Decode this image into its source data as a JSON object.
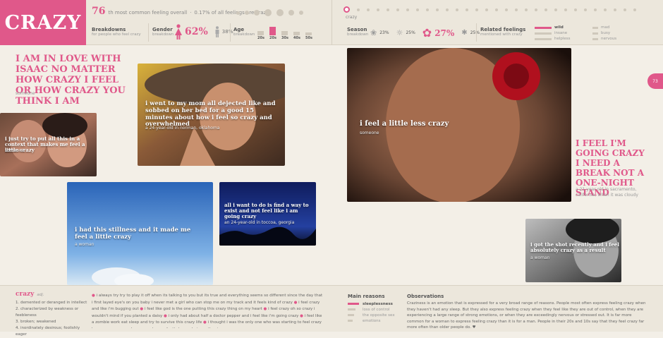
{
  "title": "CRAZY",
  "rank": {
    "number": "76",
    "suffix": "th most common feeling overall",
    "percent_text": "0.17% of all feelings are crazy"
  },
  "breakdowns": {
    "title": "Breakdowns",
    "sub": "for people who feel crazy"
  },
  "gender": {
    "title": "Gender",
    "sub": "breakdown",
    "female": "62%",
    "male": "38%"
  },
  "age": {
    "title": "Age",
    "sub": "breakdown",
    "labels": [
      "20s",
      "20s",
      "30s",
      "40s",
      "50s"
    ],
    "levels": [
      0.5,
      1.0,
      0.5,
      0.4,
      0.3
    ]
  },
  "nav_label": "crazy",
  "season": {
    "title": "Season",
    "sub": "breakdown",
    "values": [
      "23%",
      "25%",
      "27%",
      "25%"
    ]
  },
  "related": {
    "title": "Related feelings",
    "sub": "mentioned with crazy",
    "col1": [
      "wild",
      "insane",
      "helpless"
    ],
    "col2": [
      "mad",
      "busy",
      "nervous"
    ]
  },
  "page_number": "73",
  "quotes": {
    "q1": {
      "text": "i am in love with isaac no matter how crazy i feel or how crazy you think i am",
      "author": "someone"
    },
    "q2": {
      "text": "i just try to put all this in a context that makes me feel a little crazy",
      "author": "someone"
    },
    "q3": {
      "text": "i went to my mom all dejected like and sobbed on her bed for a good 15 minutes about how i feel so crazy and overwhelmed",
      "author": "a 24-year-old in norman, oklahoma"
    },
    "q4": {
      "text": "i had this stillness and it made me feel a little crazy",
      "author": "a woman"
    },
    "q5": {
      "text": "all i want to do is find a way to exist and not feel like i am going crazy",
      "author": "an 24-year-old in toccoa, georgia"
    },
    "q6": {
      "text": "i feel a little less crazy",
      "author": "someone"
    },
    "q7": {
      "text": "i feel i'm going crazy i need a break not a one-night stand",
      "author": "a 21-year-old in sacramento, california, when it was cloudy"
    },
    "q8": {
      "text": "i got the shot recently and i feel absolutely crazy as a result",
      "author": "a woman"
    }
  },
  "definition": {
    "word": "crazy",
    "pos": "adj.",
    "items": [
      "1. demented or deranged in intellect",
      "2. characterized by weakness or feebleness",
      "3. broken; weakened",
      "4. inordinately desirous; foolishly eager"
    ]
  },
  "bottom_quotes": [
    "i always try try to play it off when its talking to you but its true and everything seems so different since the day that i first layed eye's on you baby i never met a girl who can stop me on my track and it feels kind of crazy",
    "i feel crazy and like i'm bugging out",
    "i feel like god is the one putting this crazy thing on my heart",
    "i feel crazy oh so crazy i wouldn't mind if you planted a daisy",
    "i only had about half a doctor pepper and i feel like i'm going crazy",
    "i feel like a zombie work eat sleep and try to survive this crazy life",
    "i thought i was the only one who was starting to feel crazy because everyone else seemed so perfectly happy being rather insane"
  ],
  "main_reasons": {
    "title": "Main reasons",
    "items": [
      "sleeplessness",
      "loss of control",
      "the opposite sex",
      "emotions"
    ],
    "levels": [
      1.0,
      0.7,
      0.55,
      0.45
    ]
  },
  "observations": {
    "title": "Observations",
    "text": "Craziness is an emotion that is expressed for a very broad range of reasons. People most often express feeling crazy when they haven't had any sleep. But they also express feeling crazy when they feel like they are out of control, when they are experiencing a large range of strong emotions, or when they are exceedingly nervous or stressed out. It is far more common for a woman to express feeling crazy than it is for a man. People in their 20s and 10s say that they feel crazy far more often than older people do. ♥"
  },
  "colors": {
    "accent": "#e0588a",
    "muted": "#cfc8bb"
  }
}
